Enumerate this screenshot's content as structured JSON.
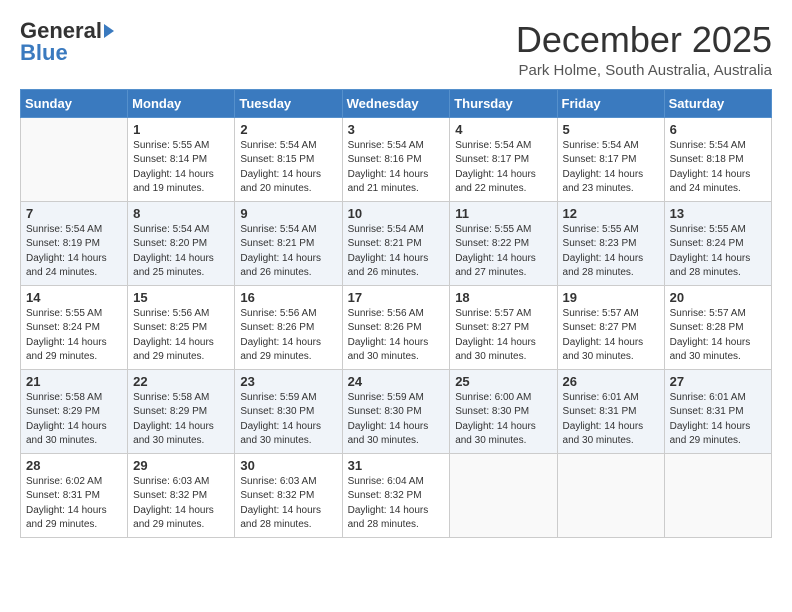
{
  "header": {
    "logo_general": "General",
    "logo_blue": "Blue",
    "month": "December 2025",
    "location": "Park Holme, South Australia, Australia"
  },
  "weekdays": [
    "Sunday",
    "Monday",
    "Tuesday",
    "Wednesday",
    "Thursday",
    "Friday",
    "Saturday"
  ],
  "weeks": [
    [
      {
        "day": "",
        "sunrise": "",
        "sunset": "",
        "daylight": "",
        "empty": true
      },
      {
        "day": "1",
        "sunrise": "Sunrise: 5:55 AM",
        "sunset": "Sunset: 8:14 PM",
        "daylight": "Daylight: 14 hours and 19 minutes."
      },
      {
        "day": "2",
        "sunrise": "Sunrise: 5:54 AM",
        "sunset": "Sunset: 8:15 PM",
        "daylight": "Daylight: 14 hours and 20 minutes."
      },
      {
        "day": "3",
        "sunrise": "Sunrise: 5:54 AM",
        "sunset": "Sunset: 8:16 PM",
        "daylight": "Daylight: 14 hours and 21 minutes."
      },
      {
        "day": "4",
        "sunrise": "Sunrise: 5:54 AM",
        "sunset": "Sunset: 8:17 PM",
        "daylight": "Daylight: 14 hours and 22 minutes."
      },
      {
        "day": "5",
        "sunrise": "Sunrise: 5:54 AM",
        "sunset": "Sunset: 8:17 PM",
        "daylight": "Daylight: 14 hours and 23 minutes."
      },
      {
        "day": "6",
        "sunrise": "Sunrise: 5:54 AM",
        "sunset": "Sunset: 8:18 PM",
        "daylight": "Daylight: 14 hours and 24 minutes."
      }
    ],
    [
      {
        "day": "7",
        "sunrise": "Sunrise: 5:54 AM",
        "sunset": "Sunset: 8:19 PM",
        "daylight": "Daylight: 14 hours and 24 minutes."
      },
      {
        "day": "8",
        "sunrise": "Sunrise: 5:54 AM",
        "sunset": "Sunset: 8:20 PM",
        "daylight": "Daylight: 14 hours and 25 minutes."
      },
      {
        "day": "9",
        "sunrise": "Sunrise: 5:54 AM",
        "sunset": "Sunset: 8:21 PM",
        "daylight": "Daylight: 14 hours and 26 minutes."
      },
      {
        "day": "10",
        "sunrise": "Sunrise: 5:54 AM",
        "sunset": "Sunset: 8:21 PM",
        "daylight": "Daylight: 14 hours and 26 minutes."
      },
      {
        "day": "11",
        "sunrise": "Sunrise: 5:55 AM",
        "sunset": "Sunset: 8:22 PM",
        "daylight": "Daylight: 14 hours and 27 minutes."
      },
      {
        "day": "12",
        "sunrise": "Sunrise: 5:55 AM",
        "sunset": "Sunset: 8:23 PM",
        "daylight": "Daylight: 14 hours and 28 minutes."
      },
      {
        "day": "13",
        "sunrise": "Sunrise: 5:55 AM",
        "sunset": "Sunset: 8:24 PM",
        "daylight": "Daylight: 14 hours and 28 minutes."
      }
    ],
    [
      {
        "day": "14",
        "sunrise": "Sunrise: 5:55 AM",
        "sunset": "Sunset: 8:24 PM",
        "daylight": "Daylight: 14 hours and 29 minutes."
      },
      {
        "day": "15",
        "sunrise": "Sunrise: 5:56 AM",
        "sunset": "Sunset: 8:25 PM",
        "daylight": "Daylight: 14 hours and 29 minutes."
      },
      {
        "day": "16",
        "sunrise": "Sunrise: 5:56 AM",
        "sunset": "Sunset: 8:26 PM",
        "daylight": "Daylight: 14 hours and 29 minutes."
      },
      {
        "day": "17",
        "sunrise": "Sunrise: 5:56 AM",
        "sunset": "Sunset: 8:26 PM",
        "daylight": "Daylight: 14 hours and 30 minutes."
      },
      {
        "day": "18",
        "sunrise": "Sunrise: 5:57 AM",
        "sunset": "Sunset: 8:27 PM",
        "daylight": "Daylight: 14 hours and 30 minutes."
      },
      {
        "day": "19",
        "sunrise": "Sunrise: 5:57 AM",
        "sunset": "Sunset: 8:27 PM",
        "daylight": "Daylight: 14 hours and 30 minutes."
      },
      {
        "day": "20",
        "sunrise": "Sunrise: 5:57 AM",
        "sunset": "Sunset: 8:28 PM",
        "daylight": "Daylight: 14 hours and 30 minutes."
      }
    ],
    [
      {
        "day": "21",
        "sunrise": "Sunrise: 5:58 AM",
        "sunset": "Sunset: 8:29 PM",
        "daylight": "Daylight: 14 hours and 30 minutes."
      },
      {
        "day": "22",
        "sunrise": "Sunrise: 5:58 AM",
        "sunset": "Sunset: 8:29 PM",
        "daylight": "Daylight: 14 hours and 30 minutes."
      },
      {
        "day": "23",
        "sunrise": "Sunrise: 5:59 AM",
        "sunset": "Sunset: 8:30 PM",
        "daylight": "Daylight: 14 hours and 30 minutes."
      },
      {
        "day": "24",
        "sunrise": "Sunrise: 5:59 AM",
        "sunset": "Sunset: 8:30 PM",
        "daylight": "Daylight: 14 hours and 30 minutes."
      },
      {
        "day": "25",
        "sunrise": "Sunrise: 6:00 AM",
        "sunset": "Sunset: 8:30 PM",
        "daylight": "Daylight: 14 hours and 30 minutes."
      },
      {
        "day": "26",
        "sunrise": "Sunrise: 6:01 AM",
        "sunset": "Sunset: 8:31 PM",
        "daylight": "Daylight: 14 hours and 30 minutes."
      },
      {
        "day": "27",
        "sunrise": "Sunrise: 6:01 AM",
        "sunset": "Sunset: 8:31 PM",
        "daylight": "Daylight: 14 hours and 29 minutes."
      }
    ],
    [
      {
        "day": "28",
        "sunrise": "Sunrise: 6:02 AM",
        "sunset": "Sunset: 8:31 PM",
        "daylight": "Daylight: 14 hours and 29 minutes."
      },
      {
        "day": "29",
        "sunrise": "Sunrise: 6:03 AM",
        "sunset": "Sunset: 8:32 PM",
        "daylight": "Daylight: 14 hours and 29 minutes."
      },
      {
        "day": "30",
        "sunrise": "Sunrise: 6:03 AM",
        "sunset": "Sunset: 8:32 PM",
        "daylight": "Daylight: 14 hours and 28 minutes."
      },
      {
        "day": "31",
        "sunrise": "Sunrise: 6:04 AM",
        "sunset": "Sunset: 8:32 PM",
        "daylight": "Daylight: 14 hours and 28 minutes."
      },
      {
        "day": "",
        "sunrise": "",
        "sunset": "",
        "daylight": "",
        "empty": true
      },
      {
        "day": "",
        "sunrise": "",
        "sunset": "",
        "daylight": "",
        "empty": true
      },
      {
        "day": "",
        "sunrise": "",
        "sunset": "",
        "daylight": "",
        "empty": true
      }
    ]
  ]
}
